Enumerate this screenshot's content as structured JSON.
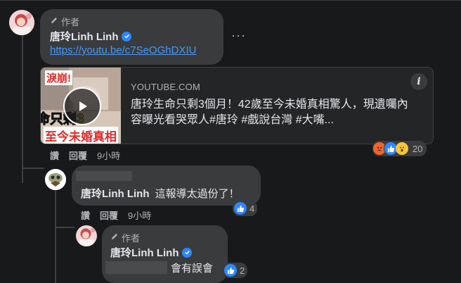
{
  "comments": [
    {
      "author_tag": "作者",
      "author": "唐玲Linh Linh",
      "link": "https://youtu.be/c7SeOGhDXIU",
      "card": {
        "source": "YOUTUBE.COM",
        "title": "唐玲生命只剩3個月！42歲至今未婚真相驚人，現遺囑內容曝光看哭眾人#唐玲 #戲說台灣 #大嘴...",
        "thumb_text_1": "淚崩!",
        "thumb_text_2": "命只剩3",
        "thumb_text_3": "至今未婚真相"
      },
      "actions": {
        "like": "讚",
        "reply": "回覆",
        "time": "9小時"
      },
      "reactions": {
        "count": "20",
        "icons": [
          "angry-icon",
          "like-icon",
          "wow-icon"
        ]
      }
    },
    {
      "author": "唐玲Linh Linh",
      "text": "這報導太過份了！",
      "actions": {
        "like": "讚",
        "reply": "回覆",
        "time": "9小時"
      },
      "reactions": {
        "count": "4"
      }
    },
    {
      "author_tag": "作者",
      "author": "唐玲Linh Linh",
      "text": "會有誤會",
      "reactions": {
        "count": "2"
      }
    }
  ],
  "colors": {
    "background": "#18191a",
    "bubble": "#3a3b3c",
    "link": "#4599ff",
    "accent": "#2d88ff"
  }
}
